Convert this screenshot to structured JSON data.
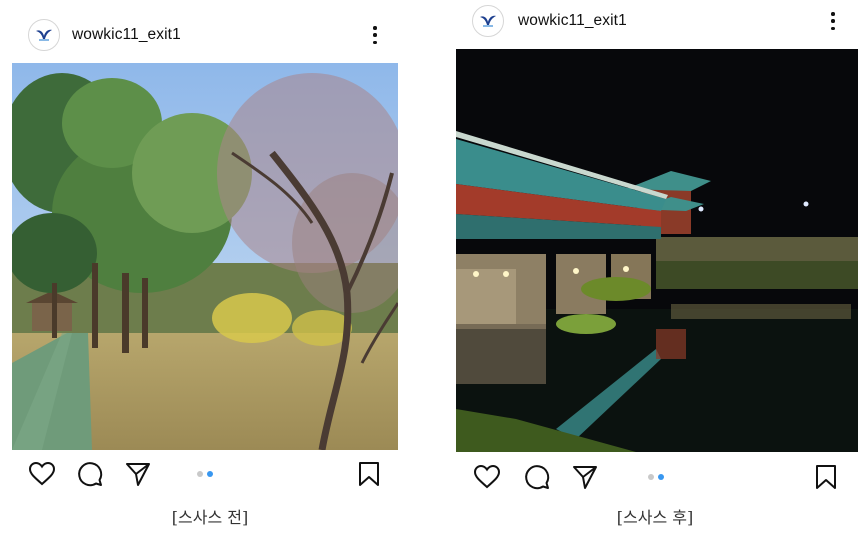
{
  "posts": [
    {
      "username": "wowkic11_exit1",
      "avatar_icon": "bird-logo-icon",
      "photo_description_icon": "park-trees-photo",
      "carousel": {
        "total": 2,
        "active": 2
      },
      "caption": "[스사스 전]"
    },
    {
      "username": "wowkic11_exit1",
      "avatar_icon": "bird-logo-icon",
      "photo_description_icon": "night-bridge-photo",
      "carousel": {
        "total": 2,
        "active": 2
      },
      "caption": "[스사스 후]"
    }
  ],
  "colors": {
    "accent_dot": "#3897f0",
    "inactive_dot": "#c9c9c9",
    "logo_blue": "#1d3f8f"
  }
}
